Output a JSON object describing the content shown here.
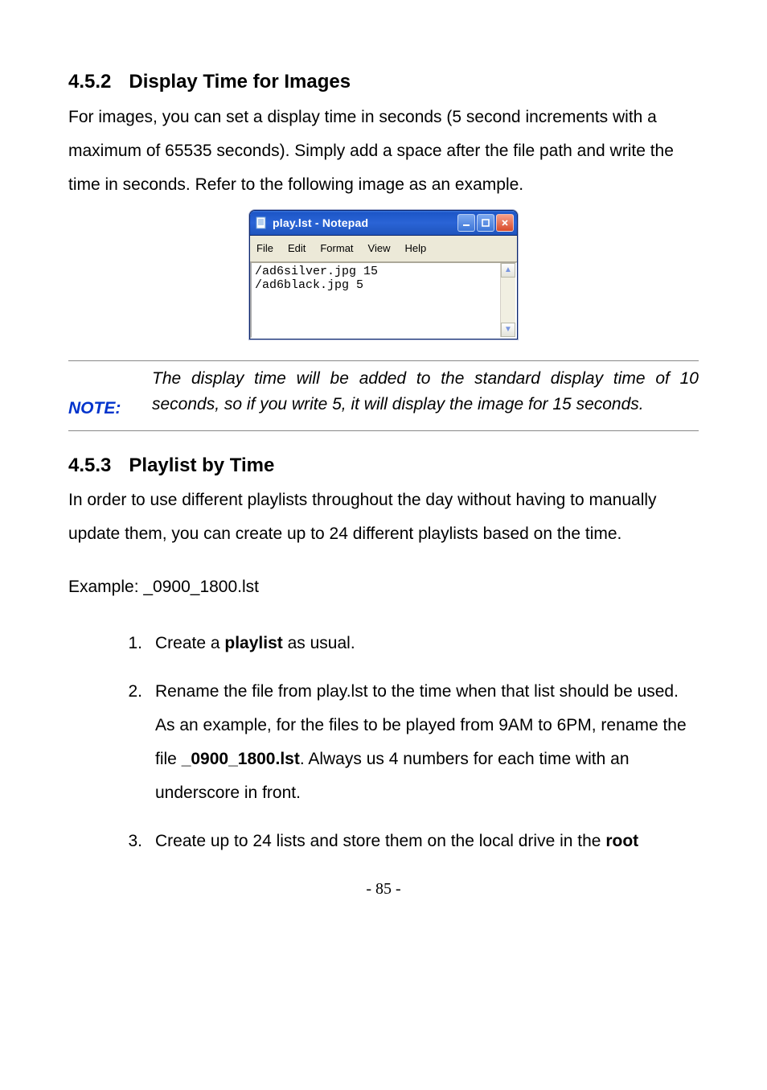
{
  "section452": {
    "number": "4.5.2",
    "title": "Display Time for Images",
    "paragraph": "For images, you can set a display time in seconds (5 second increments with a maximum of 65535 seconds). Simply add a space after the file path and write the time in seconds. Refer to the following image as an example."
  },
  "notepad": {
    "title": "play.lst - Notepad",
    "menus": {
      "file": "File",
      "edit": "Edit",
      "format": "Format",
      "view": "View",
      "help": "Help"
    },
    "content": "/ad6silver.jpg 15\n/ad6black.jpg 5"
  },
  "note": {
    "label": "NOTE:",
    "text": "The display time will be added to the standard display time of 10 seconds, so if you write 5, it will display the image for 15 seconds."
  },
  "section453": {
    "number": "4.5.3",
    "title": "Playlist by Time",
    "paragraph": "In order to use different playlists throughout the day without having to manually update them, you can create up to 24 different playlists based on the time.",
    "example_prefix": "Example: ",
    "example_value": "_0900_1800.lst",
    "steps": {
      "s1a": "Create a ",
      "s1b": "playlist",
      "s1c": " as usual.",
      "s2a": "Rename the file from play.lst to the time when that list should be used. As an example, for the files to be played from 9AM to 6PM, rename the file ",
      "s2b": "_0900_1800.lst",
      "s2c": ". Always us 4 numbers for each time with an underscore in front.",
      "s3a": "Create up to 24 lists and store them on the local drive in the ",
      "s3b": "root"
    }
  },
  "page_number": "- 85 -"
}
